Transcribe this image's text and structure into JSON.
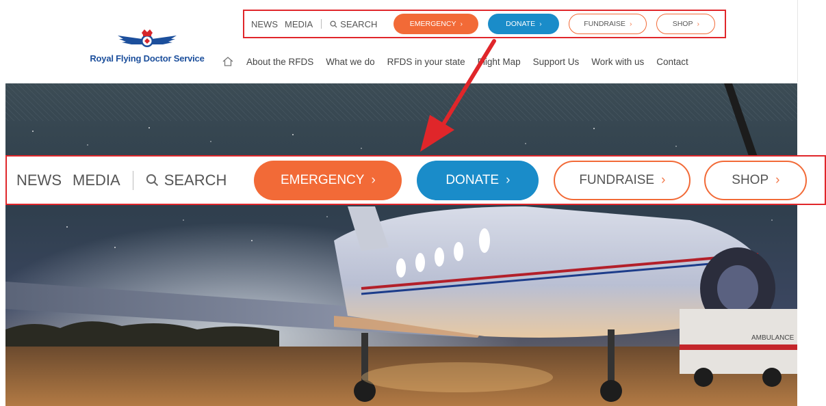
{
  "brand": {
    "name": "Royal Flying Doctor Service"
  },
  "utility": {
    "news": "NEWS",
    "media": "MEDIA",
    "search": "SEARCH",
    "emergency": "EMERGENCY",
    "donate": "DONATE",
    "fundraise": "FUNDRAISE",
    "shop": "SHOP",
    "chevron": "›"
  },
  "nav": {
    "items": [
      "About the RFDS",
      "What we do",
      "RFDS in your state",
      "Flight Map",
      "Support Us",
      "Work with us",
      "Contact"
    ]
  },
  "hero": {
    "ambulance_label": "AMBULANCE"
  },
  "colors": {
    "emergency": "#f26a37",
    "donate": "#1a8cc9",
    "highlight": "#e0262a",
    "brand_blue": "#1c4f9c"
  }
}
